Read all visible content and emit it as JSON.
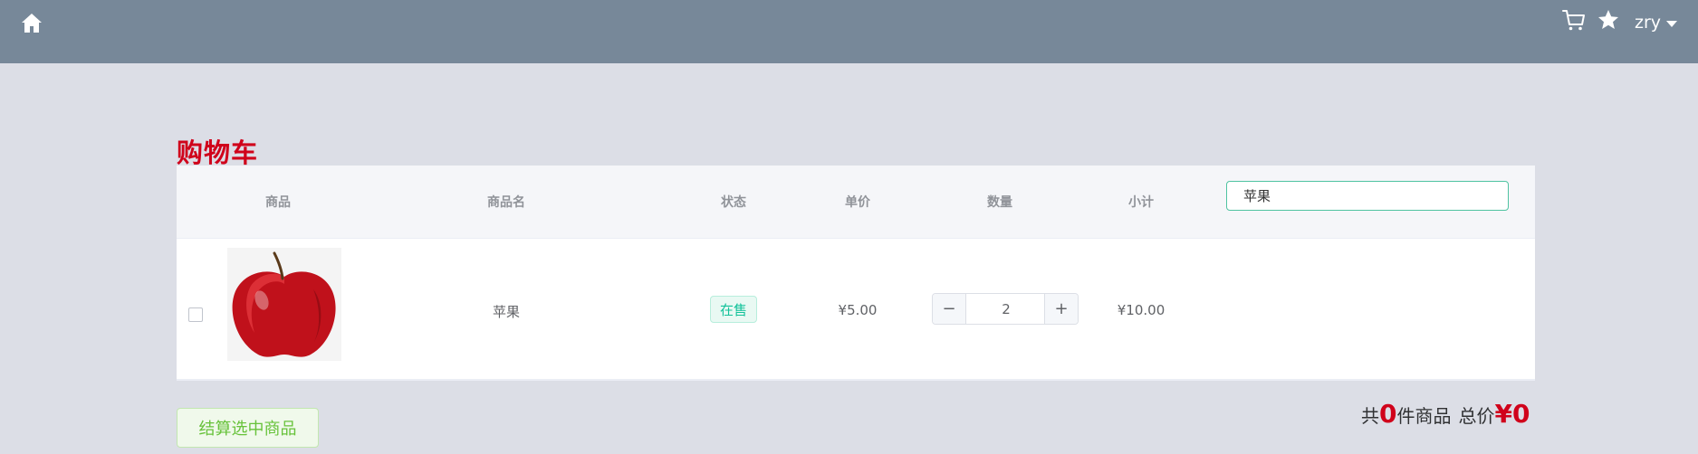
{
  "header": {
    "home_icon": "home-icon",
    "cart_icon": "cart-icon",
    "star_icon": "star-icon",
    "username": "zry",
    "bar_color": "#778899"
  },
  "page": {
    "title": "购物车",
    "title_color": "#d0021b"
  },
  "table": {
    "columns": [
      "商品",
      "商品名",
      "状态",
      "单价",
      "数量",
      "小计"
    ],
    "search_value": "苹果",
    "rows": [
      {
        "checked": false,
        "image": "red-apple-image",
        "name": "苹果",
        "status": "在售",
        "price": "¥5.00",
        "quantity": "2",
        "minus": "−",
        "plus": "+",
        "subtotal": "¥10.00"
      }
    ]
  },
  "footer": {
    "checkout_label": "结算选中商品",
    "prefix": "共",
    "count": "0",
    "count_suffix": "件商品",
    "total_label": "总价",
    "total": "¥0"
  }
}
